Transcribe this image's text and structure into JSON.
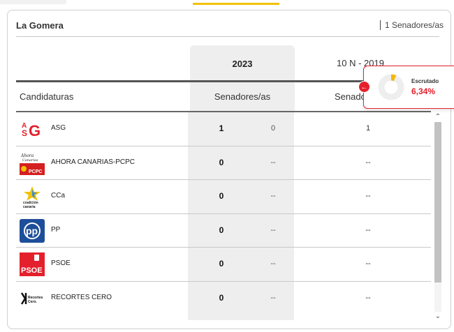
{
  "region": {
    "title": "La Gomera",
    "seats_info": "1 Senadores/as"
  },
  "columns": {
    "year_current": "2023",
    "year_previous": "10 N - 2019",
    "candidatures_header": "Candidaturas",
    "seats_header_current": "Senadores/as",
    "seats_header_previous": "Senado"
  },
  "escrutado": {
    "label": "Escrutado",
    "value": "6,34%",
    "progress_percent": 6.34,
    "accent": "#f2b705"
  },
  "colors": {
    "accent_yellow": "#f2c200",
    "alert_red": "#e4202c"
  },
  "parties": [
    {
      "name": "ASG",
      "logo": "asg-logo",
      "logo_text": "ASG",
      "seats": "1",
      "prev_seats": "0",
      "seats_2019": "1"
    },
    {
      "name": "AHORA CANARIAS-PCPC",
      "logo": "ahora-canarias-logo",
      "logo_text": "PCPC",
      "seats": "0",
      "prev_seats": "--",
      "seats_2019": "--"
    },
    {
      "name": "CCa",
      "logo": "coalicion-canaria-logo",
      "logo_text": "coalición canaria",
      "seats": "0",
      "prev_seats": "--",
      "seats_2019": "--"
    },
    {
      "name": "PP",
      "logo": "pp-logo",
      "logo_text": "PP",
      "seats": "0",
      "prev_seats": "--",
      "seats_2019": "--"
    },
    {
      "name": "PSOE",
      "logo": "psoe-logo",
      "logo_text": "PSOE",
      "seats": "0",
      "prev_seats": "--",
      "seats_2019": "--"
    },
    {
      "name": "RECORTES CERO",
      "logo": "recortes-cero-logo",
      "logo_text": "Recortes Cero.",
      "seats": "0",
      "prev_seats": "--",
      "seats_2019": "--"
    }
  ]
}
